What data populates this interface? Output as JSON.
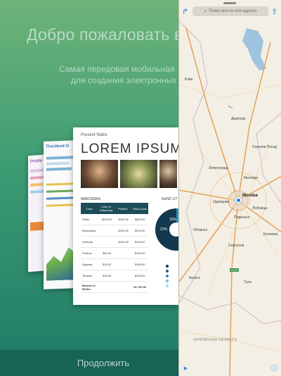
{
  "welcome": {
    "title": "Добро пожаловать в",
    "subtitle_line1": "Самая передовая мобильная",
    "subtitle_line2": "для создания электронных",
    "continue_label": "Продолжить"
  },
  "template_preview": {
    "back_card_label": "Profile",
    "mid_card_title": "Tincidunt G",
    "front_card": {
      "header": "Present Nobis",
      "headline": "LOREM IPSUM",
      "table_title": "MAECENAS",
      "chart_title": "NUNC UT",
      "table_headers": [
        "Color",
        "Color et Adipiscing",
        "Porttitor",
        "Nisus Quis"
      ],
      "table_rows": [
        [
          "Etiam",
          "$200.00",
          "$200.00",
          "$500.00"
        ],
        [
          "Malesuada",
          "",
          "$200.00",
          "$200.00"
        ],
        [
          "Vehicula",
          "",
          "$100.00",
          "$100.00"
        ],
        [
          "Pretium",
          "$50.00",
          "",
          "$150.00"
        ],
        [
          "Egestas",
          "$25.00",
          "",
          "$350.00"
        ],
        [
          "Tempeir",
          "$10.00",
          "",
          "$250.00"
        ],
        [
          "Montes et Meltur",
          "",
          "",
          "$1,750.00"
        ]
      ],
      "donut_labels": [
        "15%",
        "21%"
      ]
    }
  },
  "maps": {
    "search_placeholder": "Поиск места или адреса",
    "cities": {
      "moskva": "Москва",
      "odintsovo": "Одинцово",
      "obninsk": "Обнинск",
      "klin": "Клин",
      "dmitrov": "Дмитров",
      "sergiev": "Сергиев Посад",
      "podolsk": "Подольск",
      "serpukhov": "Серпухов",
      "kolomna": "Коломна",
      "kaluga": "Калуга",
      "tula": "Тула",
      "zelenograd": "Зеленоград",
      "lyubertsy": "Люберцы",
      "mytishchi": "Мытищи"
    },
    "region_label": "ОРЛОВСКАЯ ОБЛАСТЬ",
    "road_badge": "E105"
  }
}
